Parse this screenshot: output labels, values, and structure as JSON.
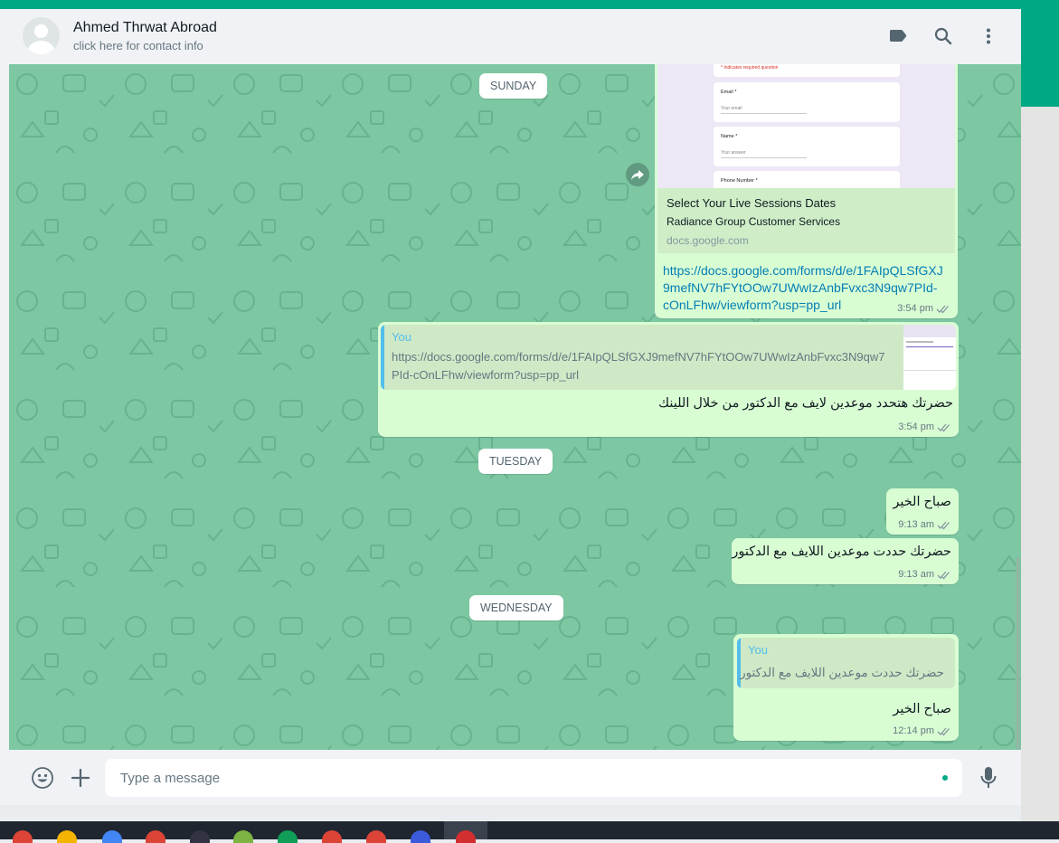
{
  "header": {
    "contact_name": "Ahmed Thrwat Abroad",
    "contact_subtitle": "click here for contact info",
    "icons": [
      "label-icon",
      "search-icon",
      "menu-icon"
    ]
  },
  "dates": {
    "sunday": "SUNDAY",
    "tuesday": "TUESDAY",
    "wednesday": "WEDNESDAY"
  },
  "messages": {
    "form_preview": {
      "form_note": "* Indicates required question",
      "field1_label": "Email *",
      "field1_placeholder": "Your email",
      "field2_label": "Name *",
      "field2_placeholder": "Your answer",
      "field3_label": "Phone Number *",
      "title": "Select Your Live Sessions Dates",
      "description": "Radiance Group Customer Services",
      "domain": "docs.google.com",
      "link_line1": "https://docs.google.com/forms/d/e/1FAIpQLSfGXJ",
      "link_line2": "9mefNV7hFYtOOw7UWwIzAnbFvxc3N9qw7PId-",
      "link_line3": "cOnLFhw/viewform?usp=pp_url",
      "time": "3:54 pm"
    },
    "reply1": {
      "quote_author": "You",
      "quote_line1": "https://docs.google.com/forms/d/e/1FAIpQLSfGXJ9mefNV7hFYtOOw7UWwIzAnbFvxc3N9qw7",
      "quote_line2": "PId-cOnLFhw/viewform?usp=pp_url",
      "text": "حضرتك هتحدد موعدين  لايف مع الدكتور من خلال اللينك",
      "time": "3:54 pm"
    },
    "morning1": {
      "text": "صباح الخير",
      "time": "9:13 am"
    },
    "morning2": {
      "text": "حضرتك حددت موعدين اللايف مع الدكتور",
      "time": "9:13 am"
    },
    "reply2": {
      "quote_author": "You",
      "quote_text": "حضرتك حددت موعدين اللايف مع الدكتور",
      "text": "صباح الخير",
      "time": "12:14 pm"
    }
  },
  "composer": {
    "placeholder": "Type a message",
    "icons": [
      "emoji-icon",
      "attach-icon",
      "microphone-icon"
    ]
  },
  "colors": {
    "accent": "#00a884",
    "chat_background": "#7dc7a3",
    "outgoing_bubble": "#d9fdd3",
    "link": "#027eb5",
    "quote_author": "#53bdeb"
  }
}
